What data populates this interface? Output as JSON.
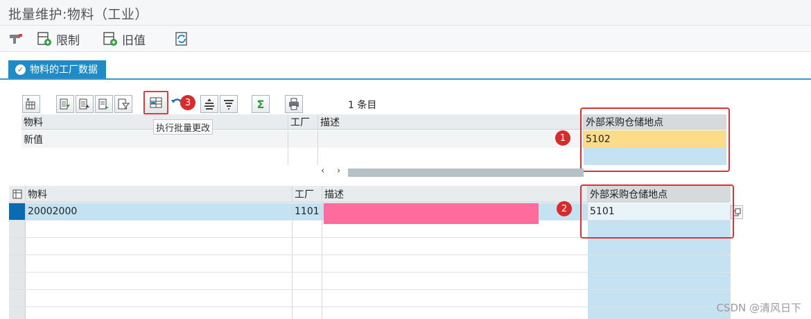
{
  "window": {
    "title": "批量维护:物料（工业）"
  },
  "toolbar": {
    "restrict_label": "限制",
    "old_value_label": "旧值"
  },
  "tab": {
    "label": "物料的工厂数据"
  },
  "alv_toolbar": {
    "row_count": "1 条目",
    "tooltip": "执行批量更改",
    "sum_glyph": "Σ"
  },
  "new_values_grid": {
    "columns": [
      "物料",
      "工厂",
      "描述",
      "外部采购仓储地点"
    ],
    "rows": [
      {
        "label": "新值",
        "storage_location": "5102"
      }
    ]
  },
  "records_grid": {
    "columns": [
      "物料",
      "工厂",
      "描述",
      "外部采购仓储地点"
    ],
    "rows": [
      {
        "material": "20002000",
        "plant": "1101",
        "description": "",
        "storage_location": "5101"
      }
    ]
  },
  "annotations": {
    "badge1": "1",
    "badge2": "2",
    "badge3": "3"
  },
  "watermark": "CSDN @清风日下",
  "colors": {
    "accent": "#1f8bc7",
    "highlight_yellow": "#fbdc8a",
    "selection_blue": "#c5e2f2",
    "redacted_pink": "#ff6b9c",
    "annotation_red": "#e03030"
  }
}
